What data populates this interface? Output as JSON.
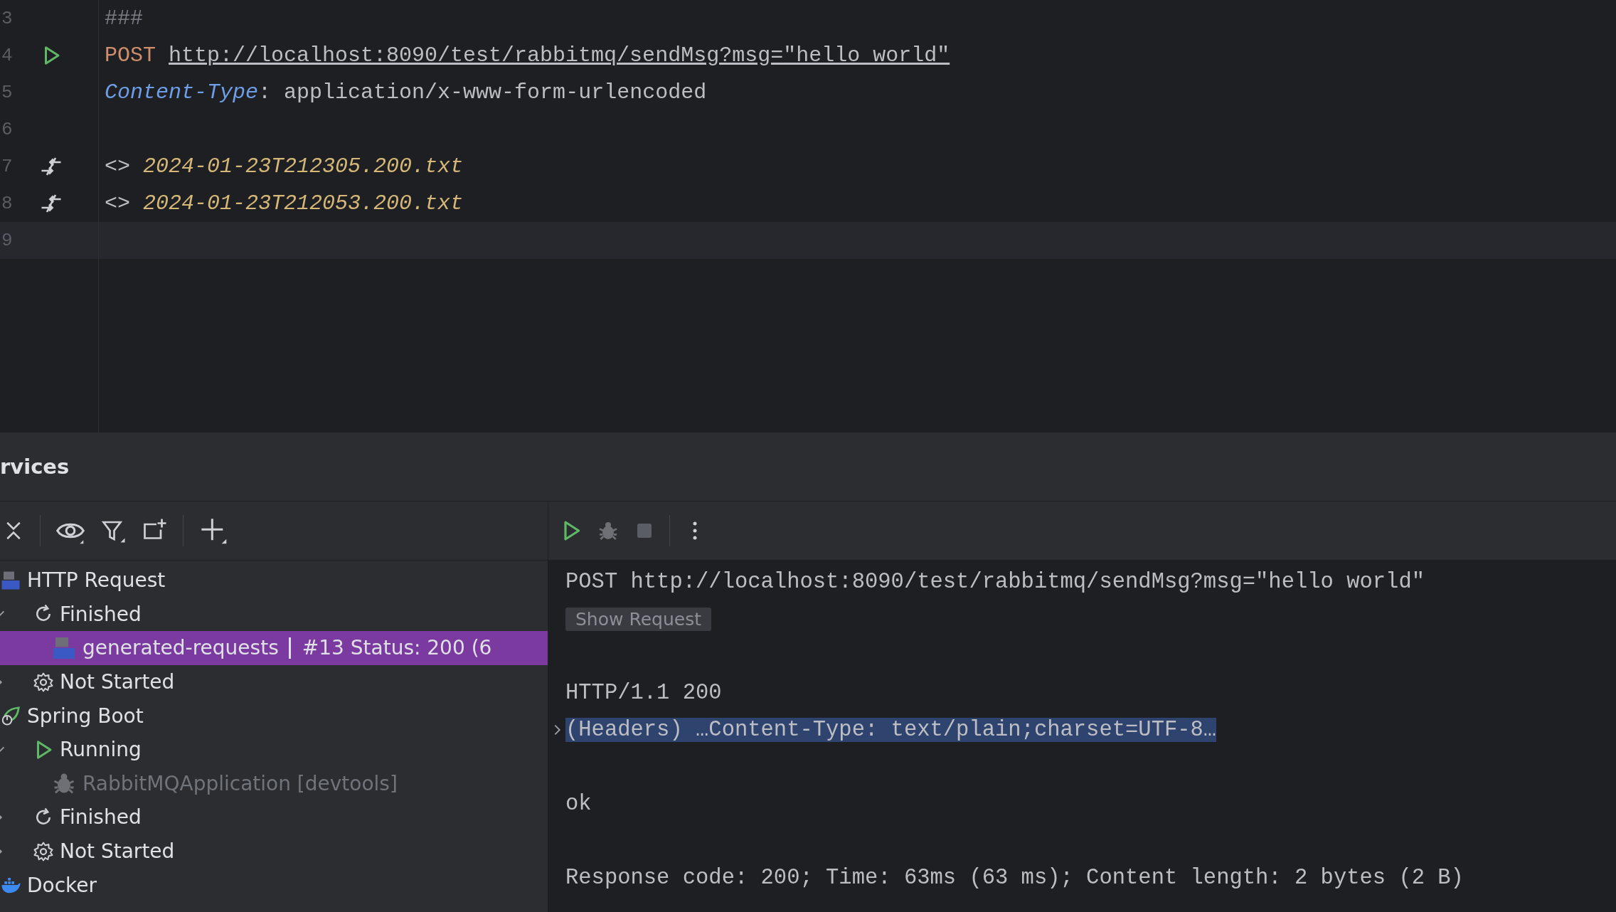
{
  "editor": {
    "lines": [
      {
        "number": "3",
        "kind": "comment",
        "text": "###",
        "current": false
      },
      {
        "number": "4",
        "kind": "request",
        "method": "POST",
        "url": "http://localhost:8090/test/rabbitmq/sendMsg?msg=\"hello world\"",
        "current": false
      },
      {
        "number": "5",
        "kind": "header",
        "name": "Content-Type",
        "separator": ":",
        "value": "application/x-www-form-urlencoded",
        "current": false
      },
      {
        "number": "6",
        "kind": "blank",
        "current": false
      },
      {
        "number": "7",
        "kind": "response_ref",
        "marker": "<>",
        "file": "2024-01-23T212305.200.txt",
        "current": false
      },
      {
        "number": "8",
        "kind": "response_ref",
        "marker": "<>",
        "file": "2024-01-23T212053.200.txt",
        "current": false
      },
      {
        "number": "9",
        "kind": "blank",
        "current": true
      }
    ]
  },
  "services": {
    "title": "rvices",
    "tree": [
      {
        "label": "HTTP Request",
        "kind": "api",
        "children": [
          {
            "label": "Finished",
            "kind": "refresh",
            "expanded": true,
            "children": [
              {
                "label": "generated-requests",
                "detail": "#13 Status: 200 (6",
                "kind": "api",
                "selected": true,
                "disabled": false
              }
            ]
          },
          {
            "label": "Not Started",
            "kind": "gear",
            "expanded": false
          }
        ]
      },
      {
        "label": "Spring Boot",
        "kind": "spring",
        "children": [
          {
            "label": "Running",
            "kind": "play",
            "expanded": true,
            "children": [
              {
                "label": "RabbitMQApplication [devtools]",
                "kind": "bug",
                "selected": false,
                "disabled": true
              }
            ]
          },
          {
            "label": "Finished",
            "kind": "refresh",
            "expanded": false
          },
          {
            "label": "Not Started",
            "kind": "gear",
            "expanded": false
          }
        ]
      },
      {
        "label": "Docker",
        "kind": "docker"
      }
    ]
  },
  "output": {
    "lines": [
      {
        "kind": "text",
        "text": "POST http://localhost:8090/test/rabbitmq/sendMsg?msg=\"hello world\""
      },
      {
        "kind": "button",
        "text": "Show Request"
      },
      {
        "kind": "blank"
      },
      {
        "kind": "text",
        "text": "HTTP/1.1 200"
      },
      {
        "kind": "fold",
        "text": "(Headers) …Content-Type: text/plain;charset=UTF-8…",
        "selected": true,
        "expanded": false
      },
      {
        "kind": "blank"
      },
      {
        "kind": "text",
        "text": "ok"
      },
      {
        "kind": "blank"
      },
      {
        "kind": "text",
        "text": "Response code: 200; Time: 63ms (63 ms); Content length: 2 bytes (2 B)"
      }
    ]
  }
}
